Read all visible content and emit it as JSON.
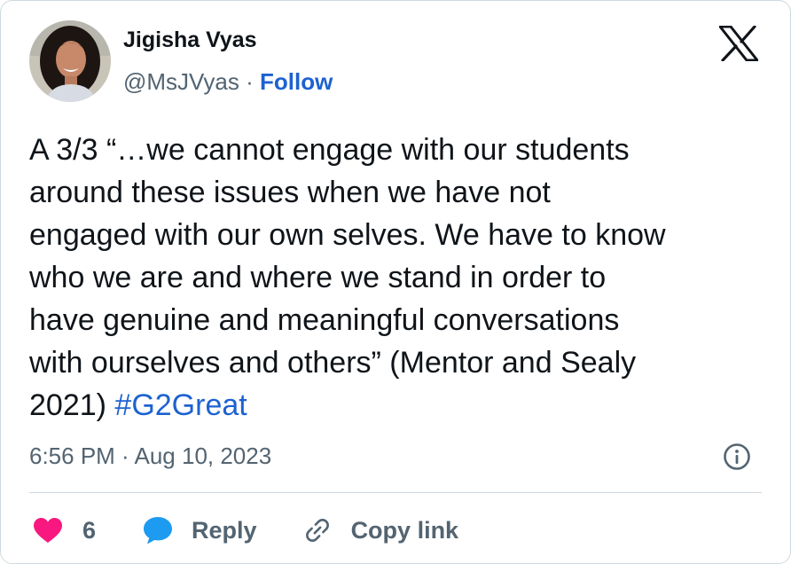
{
  "author": {
    "name": "Jigisha Vyas",
    "handle": "@MsJVyas",
    "separator": "·",
    "follow_label": "Follow",
    "avatar_icon": "profile-photo"
  },
  "brand": {
    "logo_icon": "x-logo"
  },
  "tweet": {
    "lines": [
      "A 3/3 “…we cannot engage with our students",
      "around these issues when we have not",
      "engaged with our own selves. We have to know",
      "who we are and where we stand in order to",
      "have genuine and meaningful conversations",
      "with ourselves and others” (Mentor and Sealy"
    ],
    "last_line_text": "2021) ",
    "hashtag": "#G2Great"
  },
  "meta": {
    "timestamp": "6:56 PM · Aug 10, 2023",
    "info_icon": "info-icon"
  },
  "actions": {
    "like_icon": "heart-icon",
    "like_count": "6",
    "reply_icon": "speech-bubble-icon",
    "reply_label": "Reply",
    "copy_icon": "link-icon",
    "copy_label": "Copy link"
  },
  "colors": {
    "link": "#1d62d1",
    "heart": "#f91880",
    "reply_bubble": "#1d9bf0",
    "text": "#0f1419",
    "secondary_text": "#536471",
    "divider": "#cfd9de"
  }
}
